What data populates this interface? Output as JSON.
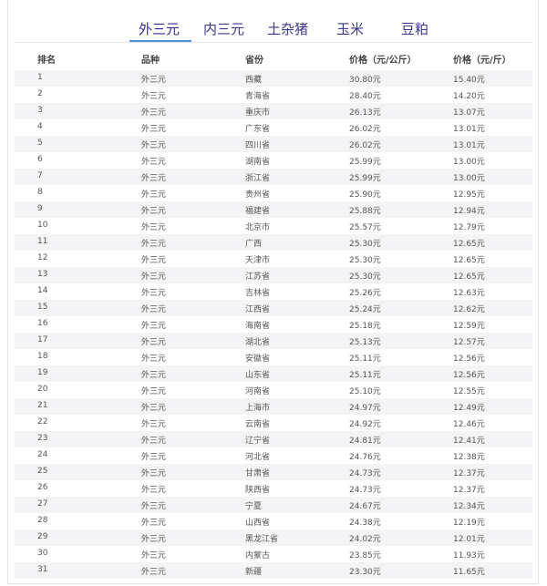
{
  "tabs": [
    {
      "label": "外三元",
      "active": true
    },
    {
      "label": "内三元",
      "active": false
    },
    {
      "label": "土杂猪",
      "active": false
    },
    {
      "label": "玉米",
      "active": false
    },
    {
      "label": "豆粕",
      "active": false
    }
  ],
  "table": {
    "headers": [
      "排名",
      "品种",
      "省份",
      "价格（元/公斤）",
      "价格（元/斤）"
    ],
    "rows": [
      [
        "1",
        "外三元",
        "西藏",
        "30.80元",
        "15.40元"
      ],
      [
        "2",
        "外三元",
        "青海省",
        "28.40元",
        "14.20元"
      ],
      [
        "3",
        "外三元",
        "重庆市",
        "26.13元",
        "13.07元"
      ],
      [
        "4",
        "外三元",
        "广东省",
        "26.02元",
        "13.01元"
      ],
      [
        "5",
        "外三元",
        "四川省",
        "26.02元",
        "13.01元"
      ],
      [
        "6",
        "外三元",
        "湖南省",
        "25.99元",
        "13.00元"
      ],
      [
        "7",
        "外三元",
        "浙江省",
        "25.99元",
        "13.00元"
      ],
      [
        "8",
        "外三元",
        "贵州省",
        "25.90元",
        "12.95元"
      ],
      [
        "9",
        "外三元",
        "福建省",
        "25.88元",
        "12.94元"
      ],
      [
        "10",
        "外三元",
        "北京市",
        "25.57元",
        "12.79元"
      ],
      [
        "11",
        "外三元",
        "广西",
        "25.30元",
        "12.65元"
      ],
      [
        "12",
        "外三元",
        "天津市",
        "25.30元",
        "12.65元"
      ],
      [
        "13",
        "外三元",
        "江苏省",
        "25.30元",
        "12.65元"
      ],
      [
        "14",
        "外三元",
        "吉林省",
        "25.26元",
        "12.63元"
      ],
      [
        "15",
        "外三元",
        "江西省",
        "25.24元",
        "12.62元"
      ],
      [
        "16",
        "外三元",
        "海南省",
        "25.18元",
        "12.59元"
      ],
      [
        "17",
        "外三元",
        "湖北省",
        "25.13元",
        "12.57元"
      ],
      [
        "18",
        "外三元",
        "安徽省",
        "25.11元",
        "12.56元"
      ],
      [
        "19",
        "外三元",
        "山东省",
        "25.11元",
        "12.56元"
      ],
      [
        "20",
        "外三元",
        "河南省",
        "25.10元",
        "12.55元"
      ],
      [
        "21",
        "外三元",
        "上海市",
        "24.97元",
        "12.49元"
      ],
      [
        "22",
        "外三元",
        "云南省",
        "24.92元",
        "12.46元"
      ],
      [
        "23",
        "外三元",
        "辽宁省",
        "24.81元",
        "12.41元"
      ],
      [
        "24",
        "外三元",
        "河北省",
        "24.76元",
        "12.38元"
      ],
      [
        "25",
        "外三元",
        "甘肃省",
        "24.73元",
        "12.37元"
      ],
      [
        "26",
        "外三元",
        "陕西省",
        "24.73元",
        "12.37元"
      ],
      [
        "27",
        "外三元",
        "宁夏",
        "24.67元",
        "12.34元"
      ],
      [
        "28",
        "外三元",
        "山西省",
        "24.38元",
        "12.19元"
      ],
      [
        "29",
        "外三元",
        "黑龙江省",
        "24.02元",
        "12.01元"
      ],
      [
        "30",
        "外三元",
        "内蒙古",
        "23.85元",
        "11.93元"
      ],
      [
        "31",
        "外三元",
        "新疆",
        "23.30元",
        "11.65元"
      ]
    ]
  },
  "colors": {
    "tab_text": "#3a3a8c",
    "tab_active_underline": "#4a8fd8",
    "row_stripe": "#f4f4f7"
  }
}
